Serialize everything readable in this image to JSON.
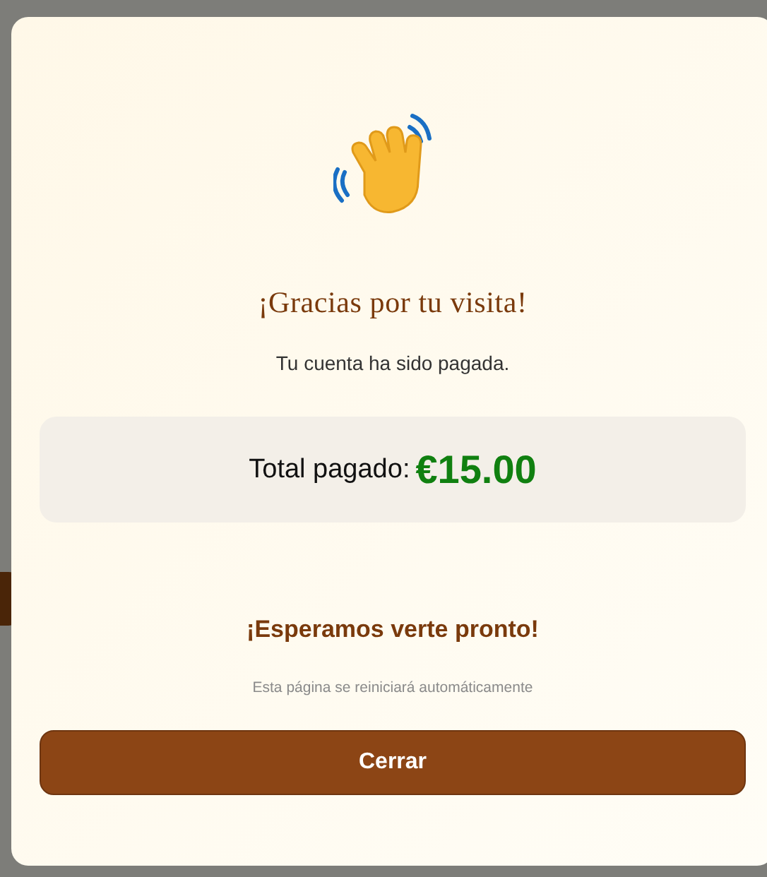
{
  "dialog": {
    "title": "¡Gracias por tu visita!",
    "message": "Tu cuenta ha sido pagada.",
    "total": {
      "label": "Total pagado:",
      "amount": "€15.00"
    },
    "farewell": "¡Esperamos verte pronto!",
    "note": "Esta página se reiniciará automáticamente",
    "button": "Cerrar"
  }
}
